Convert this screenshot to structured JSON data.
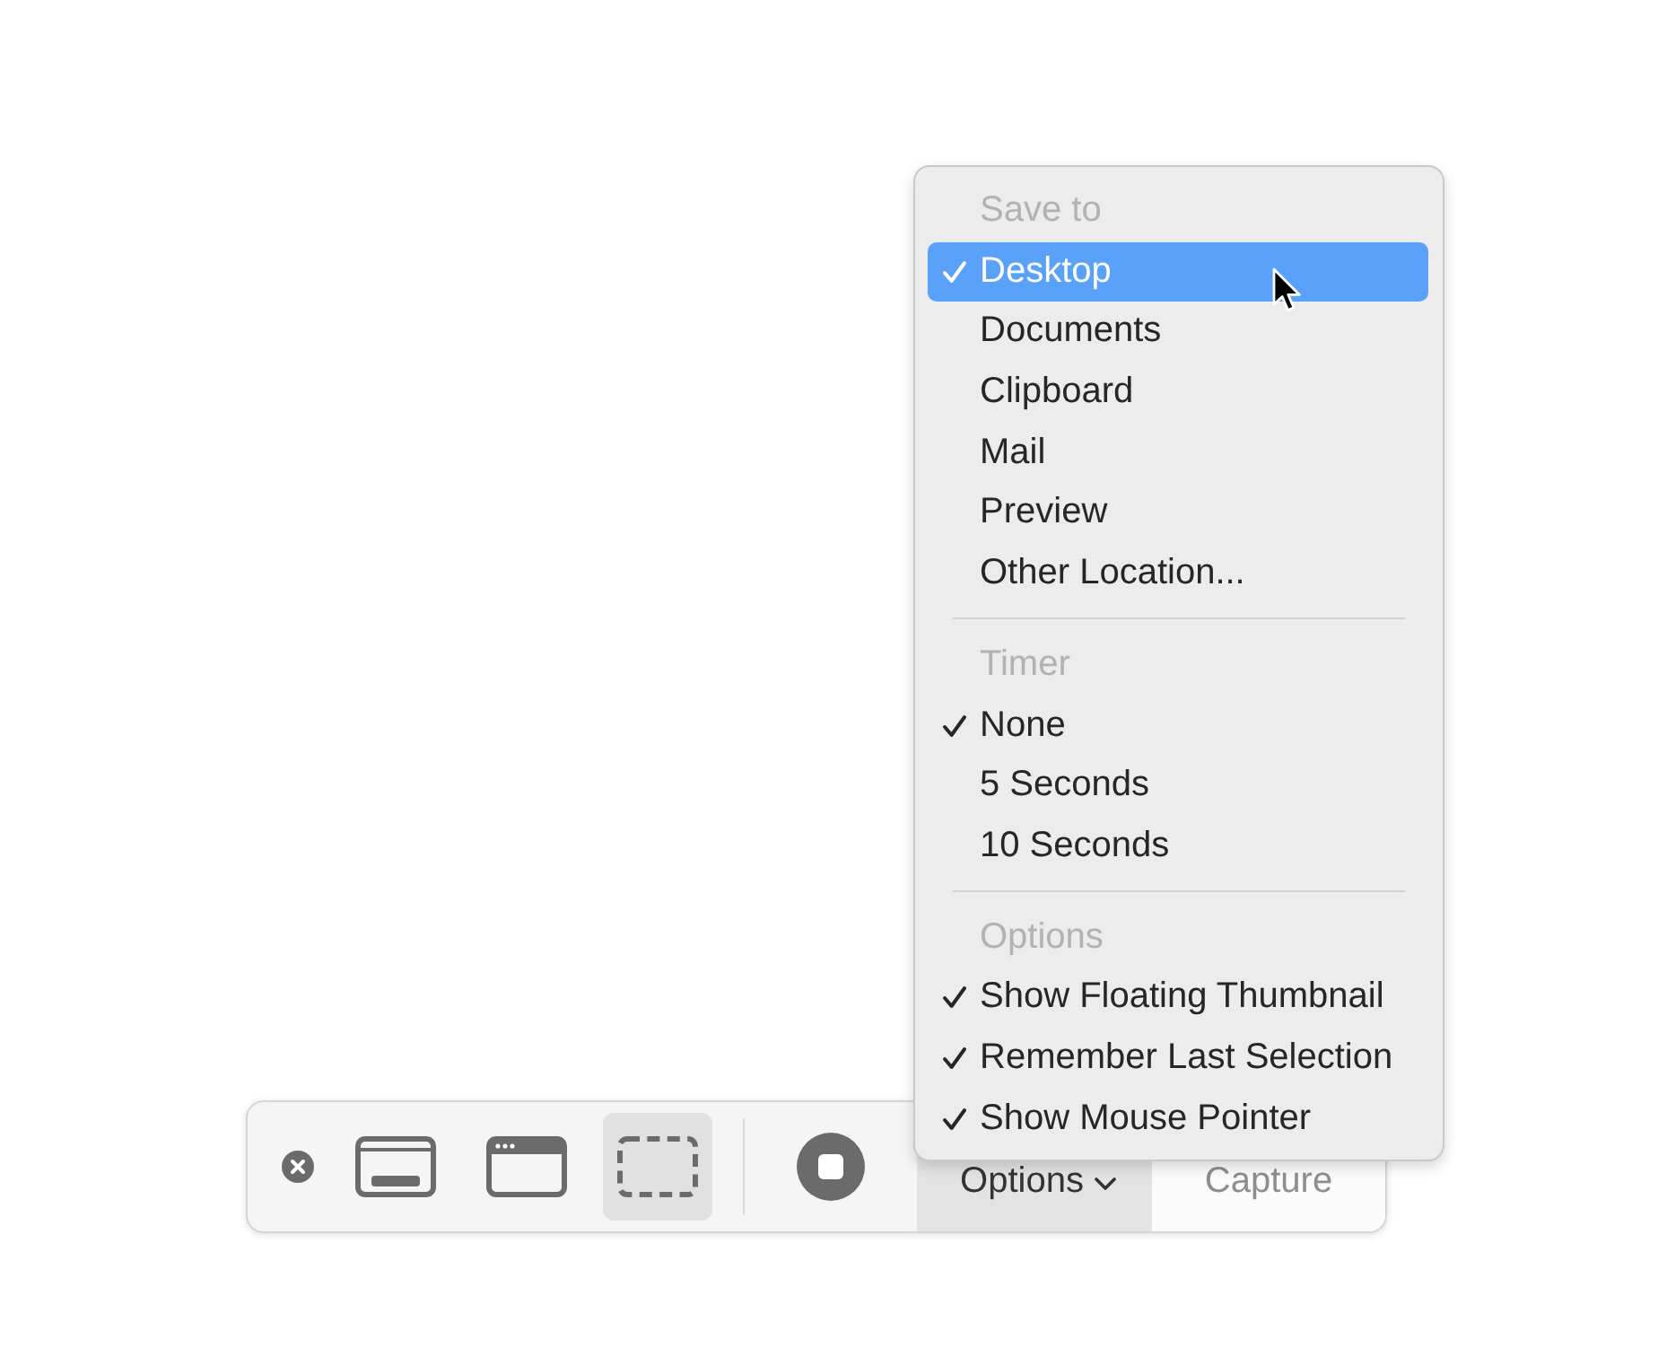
{
  "toolbar": {
    "capture_tools": [
      {
        "kind": "screen",
        "selected": false
      },
      {
        "kind": "window",
        "selected": false
      },
      {
        "kind": "selection",
        "selected": true
      }
    ],
    "record_tools": [
      {
        "kind": "record",
        "selected": false
      }
    ],
    "options_button": {
      "label": "Options",
      "selected": true
    },
    "capture_button": {
      "label": "Capture",
      "disabled": true
    }
  },
  "menu": {
    "sections": [
      {
        "header": "Save to",
        "items": [
          {
            "label": "Desktop",
            "checked": true,
            "selected": true
          },
          {
            "label": "Documents",
            "checked": false,
            "selected": false
          },
          {
            "label": "Clipboard",
            "checked": false,
            "selected": false
          },
          {
            "label": "Mail",
            "checked": false,
            "selected": false
          },
          {
            "label": "Preview",
            "checked": false,
            "selected": false
          },
          {
            "label": "Other Location...",
            "checked": false,
            "selected": false
          }
        ]
      },
      {
        "header": "Timer",
        "items": [
          {
            "label": "None",
            "checked": true,
            "selected": false
          },
          {
            "label": "5 Seconds",
            "checked": false,
            "selected": false
          },
          {
            "label": "10 Seconds",
            "checked": false,
            "selected": false
          }
        ]
      },
      {
        "header": "Options",
        "items": [
          {
            "label": "Show Floating Thumbnail",
            "checked": true,
            "selected": false
          },
          {
            "label": "Remember Last Selection",
            "checked": true,
            "selected": false
          },
          {
            "label": "Show Mouse Pointer",
            "checked": true,
            "selected": false
          }
        ]
      }
    ]
  }
}
